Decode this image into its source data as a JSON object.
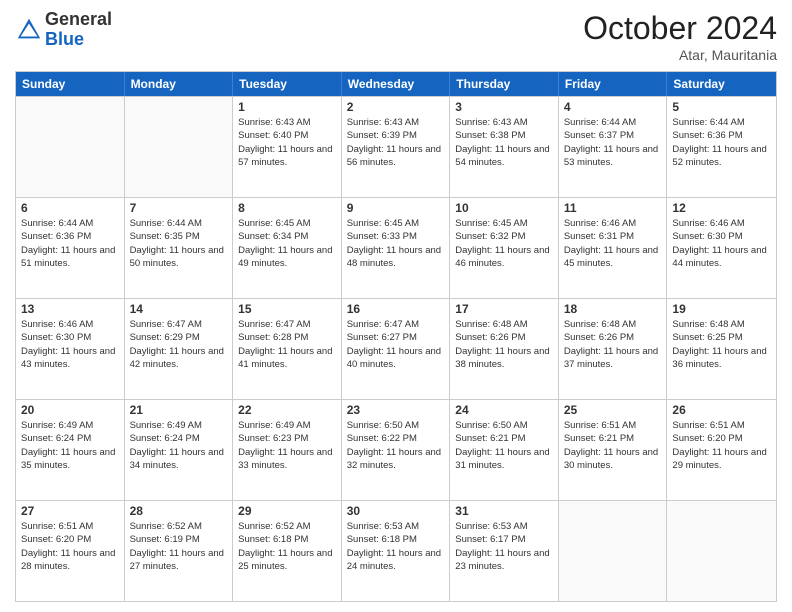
{
  "logo": {
    "general": "General",
    "blue": "Blue"
  },
  "header": {
    "month": "October 2024",
    "location": "Atar, Mauritania"
  },
  "weekdays": [
    "Sunday",
    "Monday",
    "Tuesday",
    "Wednesday",
    "Thursday",
    "Friday",
    "Saturday"
  ],
  "rows": [
    [
      {
        "day": "",
        "empty": true
      },
      {
        "day": "",
        "empty": true
      },
      {
        "day": "1",
        "sunrise": "Sunrise: 6:43 AM",
        "sunset": "Sunset: 6:40 PM",
        "daylight": "Daylight: 11 hours and 57 minutes."
      },
      {
        "day": "2",
        "sunrise": "Sunrise: 6:43 AM",
        "sunset": "Sunset: 6:39 PM",
        "daylight": "Daylight: 11 hours and 56 minutes."
      },
      {
        "day": "3",
        "sunrise": "Sunrise: 6:43 AM",
        "sunset": "Sunset: 6:38 PM",
        "daylight": "Daylight: 11 hours and 54 minutes."
      },
      {
        "day": "4",
        "sunrise": "Sunrise: 6:44 AM",
        "sunset": "Sunset: 6:37 PM",
        "daylight": "Daylight: 11 hours and 53 minutes."
      },
      {
        "day": "5",
        "sunrise": "Sunrise: 6:44 AM",
        "sunset": "Sunset: 6:36 PM",
        "daylight": "Daylight: 11 hours and 52 minutes."
      }
    ],
    [
      {
        "day": "6",
        "sunrise": "Sunrise: 6:44 AM",
        "sunset": "Sunset: 6:36 PM",
        "daylight": "Daylight: 11 hours and 51 minutes."
      },
      {
        "day": "7",
        "sunrise": "Sunrise: 6:44 AM",
        "sunset": "Sunset: 6:35 PM",
        "daylight": "Daylight: 11 hours and 50 minutes."
      },
      {
        "day": "8",
        "sunrise": "Sunrise: 6:45 AM",
        "sunset": "Sunset: 6:34 PM",
        "daylight": "Daylight: 11 hours and 49 minutes."
      },
      {
        "day": "9",
        "sunrise": "Sunrise: 6:45 AM",
        "sunset": "Sunset: 6:33 PM",
        "daylight": "Daylight: 11 hours and 48 minutes."
      },
      {
        "day": "10",
        "sunrise": "Sunrise: 6:45 AM",
        "sunset": "Sunset: 6:32 PM",
        "daylight": "Daylight: 11 hours and 46 minutes."
      },
      {
        "day": "11",
        "sunrise": "Sunrise: 6:46 AM",
        "sunset": "Sunset: 6:31 PM",
        "daylight": "Daylight: 11 hours and 45 minutes."
      },
      {
        "day": "12",
        "sunrise": "Sunrise: 6:46 AM",
        "sunset": "Sunset: 6:30 PM",
        "daylight": "Daylight: 11 hours and 44 minutes."
      }
    ],
    [
      {
        "day": "13",
        "sunrise": "Sunrise: 6:46 AM",
        "sunset": "Sunset: 6:30 PM",
        "daylight": "Daylight: 11 hours and 43 minutes."
      },
      {
        "day": "14",
        "sunrise": "Sunrise: 6:47 AM",
        "sunset": "Sunset: 6:29 PM",
        "daylight": "Daylight: 11 hours and 42 minutes."
      },
      {
        "day": "15",
        "sunrise": "Sunrise: 6:47 AM",
        "sunset": "Sunset: 6:28 PM",
        "daylight": "Daylight: 11 hours and 41 minutes."
      },
      {
        "day": "16",
        "sunrise": "Sunrise: 6:47 AM",
        "sunset": "Sunset: 6:27 PM",
        "daylight": "Daylight: 11 hours and 40 minutes."
      },
      {
        "day": "17",
        "sunrise": "Sunrise: 6:48 AM",
        "sunset": "Sunset: 6:26 PM",
        "daylight": "Daylight: 11 hours and 38 minutes."
      },
      {
        "day": "18",
        "sunrise": "Sunrise: 6:48 AM",
        "sunset": "Sunset: 6:26 PM",
        "daylight": "Daylight: 11 hours and 37 minutes."
      },
      {
        "day": "19",
        "sunrise": "Sunrise: 6:48 AM",
        "sunset": "Sunset: 6:25 PM",
        "daylight": "Daylight: 11 hours and 36 minutes."
      }
    ],
    [
      {
        "day": "20",
        "sunrise": "Sunrise: 6:49 AM",
        "sunset": "Sunset: 6:24 PM",
        "daylight": "Daylight: 11 hours and 35 minutes."
      },
      {
        "day": "21",
        "sunrise": "Sunrise: 6:49 AM",
        "sunset": "Sunset: 6:24 PM",
        "daylight": "Daylight: 11 hours and 34 minutes."
      },
      {
        "day": "22",
        "sunrise": "Sunrise: 6:49 AM",
        "sunset": "Sunset: 6:23 PM",
        "daylight": "Daylight: 11 hours and 33 minutes."
      },
      {
        "day": "23",
        "sunrise": "Sunrise: 6:50 AM",
        "sunset": "Sunset: 6:22 PM",
        "daylight": "Daylight: 11 hours and 32 minutes."
      },
      {
        "day": "24",
        "sunrise": "Sunrise: 6:50 AM",
        "sunset": "Sunset: 6:21 PM",
        "daylight": "Daylight: 11 hours and 31 minutes."
      },
      {
        "day": "25",
        "sunrise": "Sunrise: 6:51 AM",
        "sunset": "Sunset: 6:21 PM",
        "daylight": "Daylight: 11 hours and 30 minutes."
      },
      {
        "day": "26",
        "sunrise": "Sunrise: 6:51 AM",
        "sunset": "Sunset: 6:20 PM",
        "daylight": "Daylight: 11 hours and 29 minutes."
      }
    ],
    [
      {
        "day": "27",
        "sunrise": "Sunrise: 6:51 AM",
        "sunset": "Sunset: 6:20 PM",
        "daylight": "Daylight: 11 hours and 28 minutes."
      },
      {
        "day": "28",
        "sunrise": "Sunrise: 6:52 AM",
        "sunset": "Sunset: 6:19 PM",
        "daylight": "Daylight: 11 hours and 27 minutes."
      },
      {
        "day": "29",
        "sunrise": "Sunrise: 6:52 AM",
        "sunset": "Sunset: 6:18 PM",
        "daylight": "Daylight: 11 hours and 25 minutes."
      },
      {
        "day": "30",
        "sunrise": "Sunrise: 6:53 AM",
        "sunset": "Sunset: 6:18 PM",
        "daylight": "Daylight: 11 hours and 24 minutes."
      },
      {
        "day": "31",
        "sunrise": "Sunrise: 6:53 AM",
        "sunset": "Sunset: 6:17 PM",
        "daylight": "Daylight: 11 hours and 23 minutes."
      },
      {
        "day": "",
        "empty": true
      },
      {
        "day": "",
        "empty": true
      }
    ]
  ]
}
